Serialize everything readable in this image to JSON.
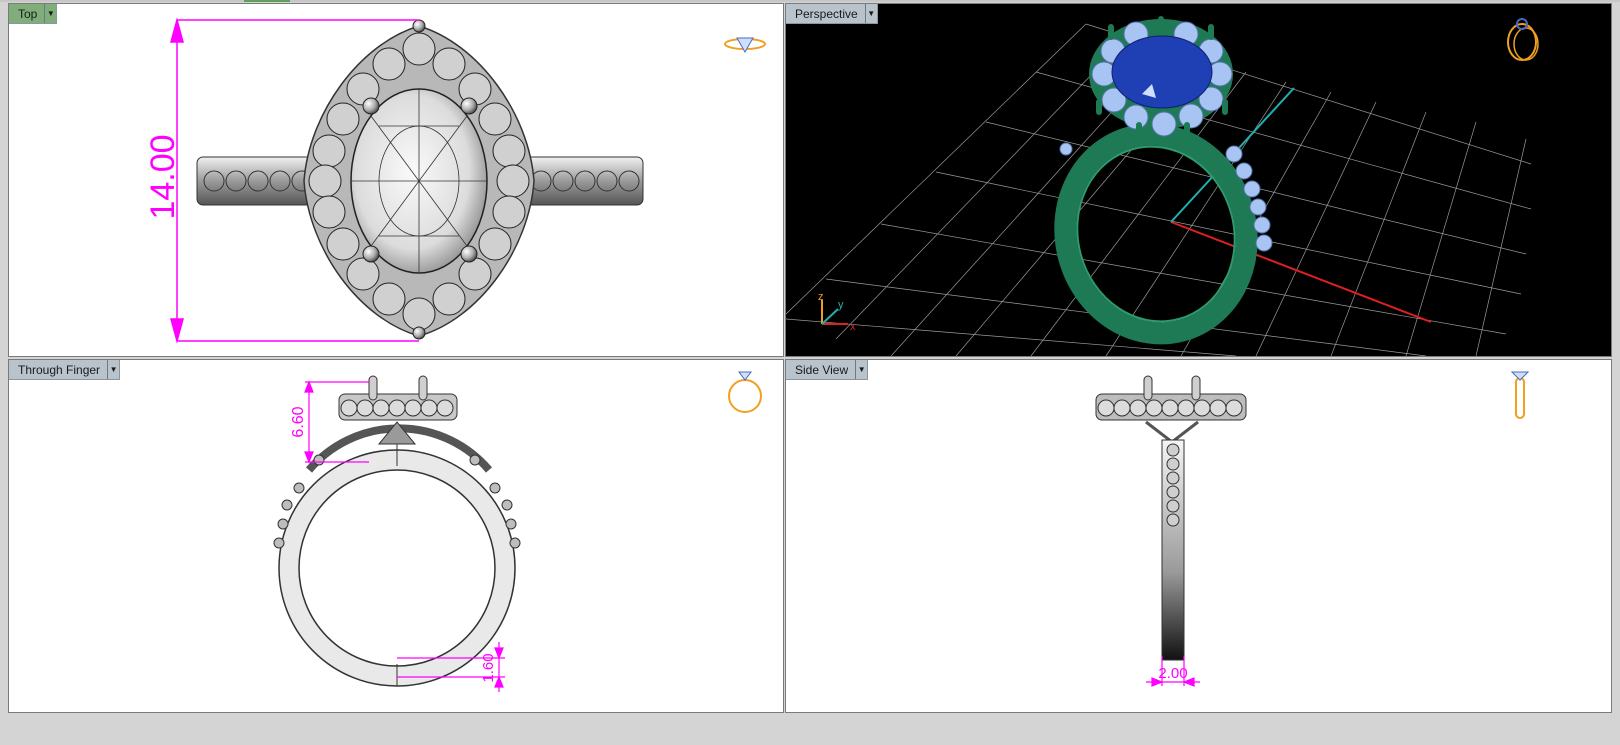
{
  "viewports": {
    "top": {
      "label": "Top",
      "dimension": "14.00"
    },
    "perspective": {
      "label": "Perspective",
      "axis_x": "x",
      "axis_y": "y",
      "axis_z": "z"
    },
    "through_finger": {
      "label": "Through Finger",
      "dim_height": "6.60",
      "dim_thickness": "1.60"
    },
    "side_view": {
      "label": "Side View",
      "dim_width": "2.00"
    }
  },
  "icons": {
    "top": "ring-top-thumbnail-icon",
    "perspective": "ring-perspective-thumbnail-icon",
    "through_finger": "ring-front-thumbnail-icon",
    "side_view": "ring-side-thumbnail-icon"
  },
  "colors": {
    "dimension": "#ff00ff",
    "active_label": "#7fae7a",
    "label": "#b9c3cc",
    "ring_green": "#1e7a55",
    "center_stone": "#1f3fb5",
    "halo_stone": "#a8c4f2",
    "grid": "#bdbdbd",
    "axis_x": "#e02020",
    "axis_y": "#20b0b0",
    "thumbnail": "#f0a020"
  }
}
